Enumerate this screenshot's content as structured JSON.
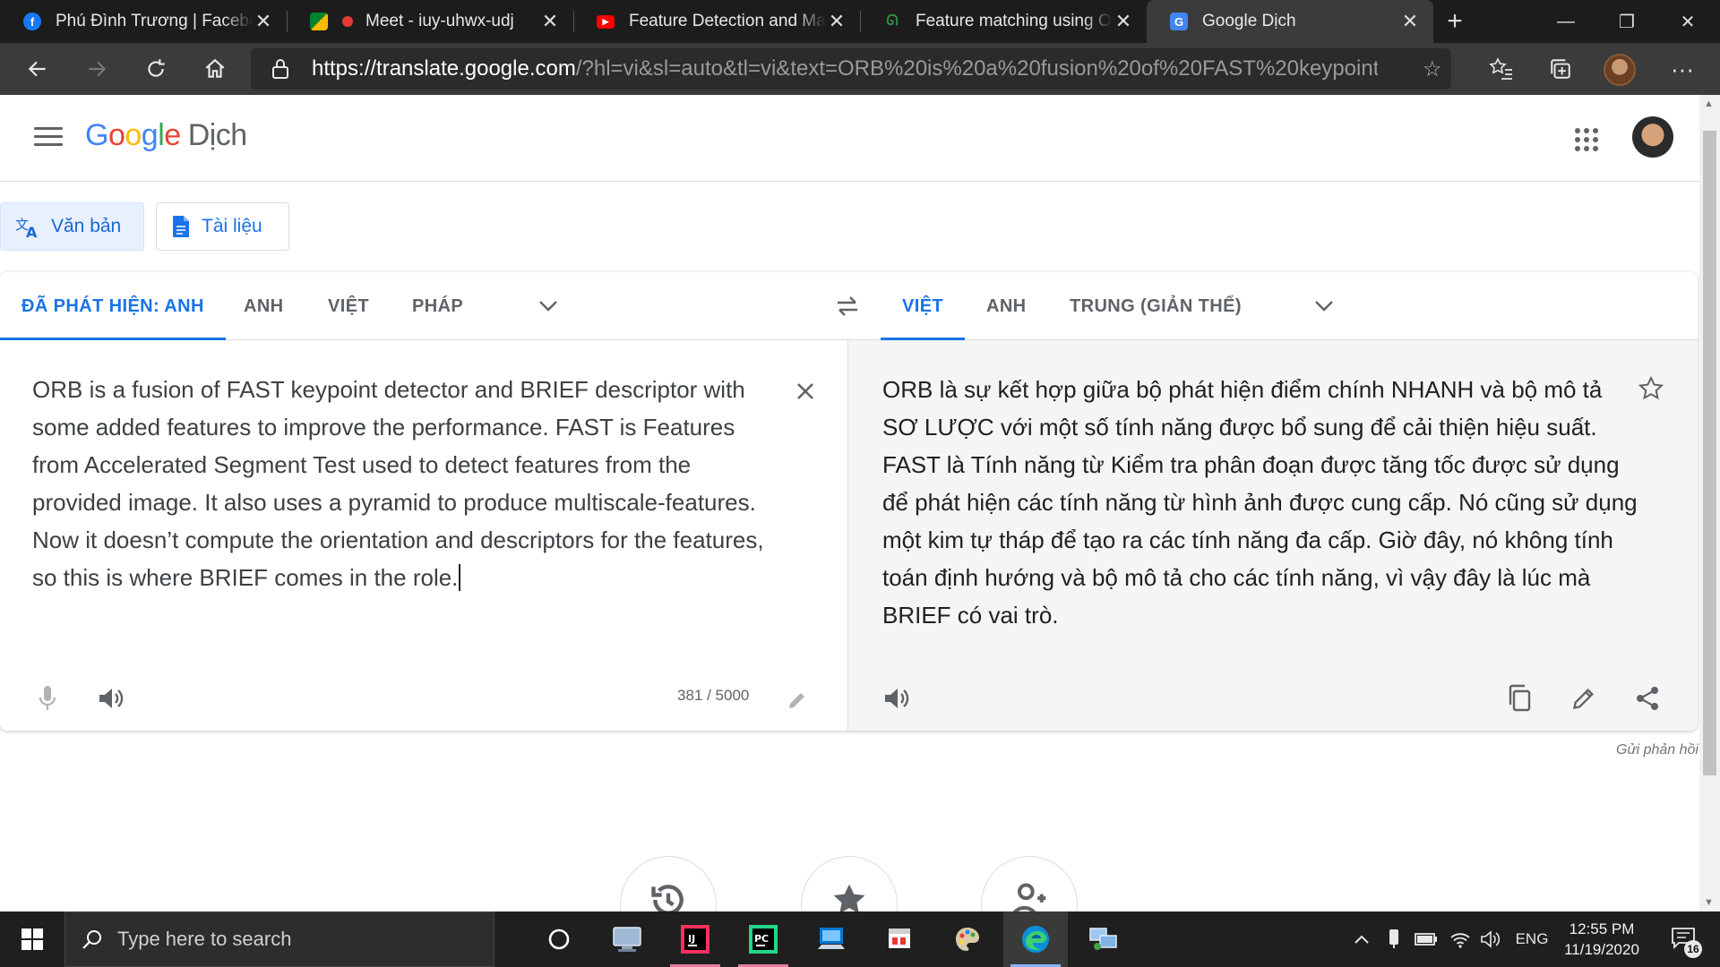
{
  "browser": {
    "tabs": [
      {
        "title": "Phú Đình Trương | Facebook",
        "favicon": "facebook-icon",
        "color": "#1877f2",
        "active": false
      },
      {
        "title": "Meet - iuy-uhwx-udj",
        "favicon": "google-meet-icon",
        "color": "#00832d",
        "active": false
      },
      {
        "title": "Feature Detection and Matching",
        "favicon": "youtube-icon",
        "color": "#ff0000",
        "active": false
      },
      {
        "title": "Feature matching using ORB",
        "favicon": "geeksforgeeks-icon",
        "color": "#2f8d46",
        "active": false
      },
      {
        "title": "Google Dịch",
        "favicon": "google-translate-icon",
        "color": "#4285f4",
        "active": true
      }
    ],
    "url_host": "https://translate.google.com",
    "url_rest": "/?hl=vi&sl=auto&tl=vi&text=ORB%20is%20a%20fusion%20of%20FAST%20keypoint..."
  },
  "header": {
    "logo_google": "Google",
    "logo_product": "Dịch"
  },
  "modes": {
    "text_label": "Văn bản",
    "doc_label": "Tài liệu"
  },
  "source_langs": [
    "ĐÃ PHÁT HIỆN: ANH",
    "ANH",
    "VIỆT",
    "PHÁP"
  ],
  "target_langs": [
    "VIỆT",
    "ANH",
    "TRUNG (GIẢN THỂ)"
  ],
  "source": {
    "text": "ORB is a fusion of FAST keypoint detector and BRIEF descriptor with some added features to improve the performance. FAST is Features from Accelerated Segment Test used to detect features from the provided image. It also uses a pyramid to produce multiscale-features. Now it doesn’t compute the orientation and descriptors for the features, so this is where BRIEF comes in the role.",
    "char_count": "381 / 5000"
  },
  "target": {
    "text": "ORB là sự kết hợp giữa bộ phát hiện điểm chính NHANH và bộ mô tả SƠ LƯỢC với một số tính năng được bổ sung để cải thiện hiệu suất. FAST là Tính năng từ Kiểm tra phân đoạn được tăng tốc được sử dụng để phát hiện các tính năng từ hình ảnh được cung cấp. Nó cũng sử dụng một kim tự tháp để tạo ra các tính năng đa cấp. Giờ đây, nó không tính toán định hướng và bộ mô tả cho các tính năng, vì vậy đây là lúc mà BRIEF có vai trò."
  },
  "feedback_label": "Gửi phản hồi",
  "taskbar": {
    "search_placeholder": "Type here to search",
    "language": "ENG",
    "time": "12:55 PM",
    "date": "11/19/2020",
    "notification_count": "16"
  },
  "colors": {
    "accent": "#1a73e8",
    "chrome_dark": "#1c1c1c",
    "chrome_mid": "#3b3b3b"
  }
}
